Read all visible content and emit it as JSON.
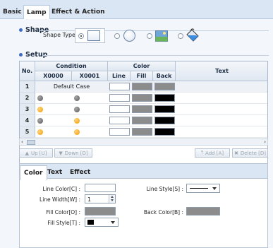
{
  "tabs": [
    "Basic",
    "Lamp",
    "Effect & Action"
  ],
  "shape": {
    "title": "Shape",
    "type_label": "Shape Type :"
  },
  "setup": {
    "title": "Setup",
    "headers": {
      "no": "No.",
      "condition": "Condition",
      "color": "Color",
      "text": "Text",
      "x0000": "X0000",
      "x0001": "X0001",
      "line": "Line",
      "fill": "Fill",
      "back": "Back"
    },
    "rows": [
      {
        "no": "1",
        "default": "Default Case",
        "x0000": "",
        "x0001": "",
        "line": "#ffffff",
        "fill": "#8c8c8c",
        "back": "#8c8c8c"
      },
      {
        "no": "2",
        "x0000": "gray",
        "x0001": "gray",
        "line": "#ffffff",
        "fill": "#8c8c8c",
        "back": "#000000"
      },
      {
        "no": "3",
        "x0000": "orange",
        "x0001": "gray",
        "line": "#ffffff",
        "fill": "#8c8c8c",
        "back": "#000000"
      },
      {
        "no": "4",
        "x0000": "gray",
        "x0001": "orange",
        "line": "#ffffff",
        "fill": "#8c8c8c",
        "back": "#000000"
      },
      {
        "no": "5",
        "x0000": "orange",
        "x0001": "orange",
        "line": "#ffffff",
        "fill": "#8c8c8c",
        "back": "#000000"
      }
    ]
  },
  "buttons": {
    "up": "Up [U]",
    "down": "Down [D]",
    "add": "Add [A]",
    "delete": "Delete [D]"
  },
  "props": {
    "tabs": [
      "Color",
      "Text",
      "Effect"
    ],
    "line_color_label": "Line Color[C] :",
    "line_width_label": "Line Width[W] :",
    "line_width_value": "1",
    "fill_color_label": "Fill Color[O] :",
    "fill_style_label": "Fill Style[T] :",
    "line_style_label": "Line Style[S] :",
    "back_color_label": "Back Color[B] :"
  },
  "colors": {
    "line": "#ffffff",
    "fill": "#8c8c8c",
    "back": "#000000",
    "lamp_gray": "#808080",
    "lamp_orange": "#f5a300"
  }
}
